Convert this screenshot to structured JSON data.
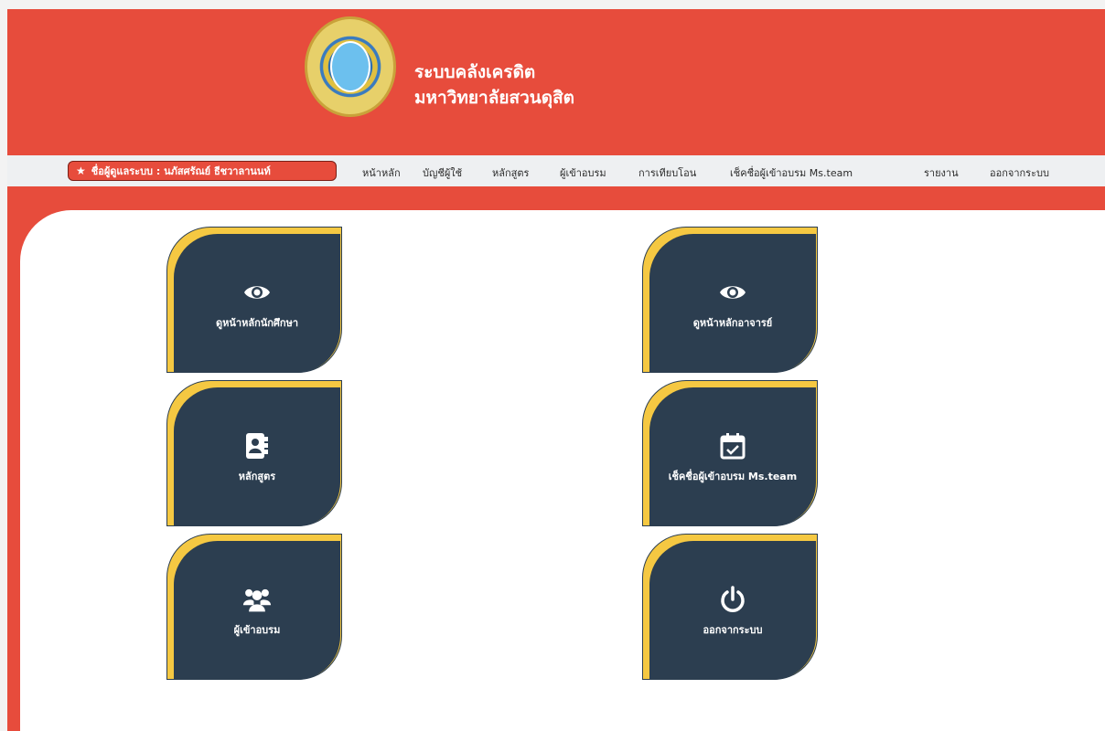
{
  "header": {
    "title_line1": "ระบบคลังเครดิต",
    "title_line2": "มหาวิทยาลัยสวนดุสิต"
  },
  "nav": {
    "admin_label": "ชื่อผู้ดูแลระบบ : นภัสศรัณย์ ธีชวาลานนท์",
    "items": [
      "หน้าหลัก",
      "บัญชีผู้ใช้",
      "หลักสูตร",
      "ผู้เข้าอบรม",
      "การเทียบโอน",
      "เช็คชื่อผู้เข้าอบรม Ms.team",
      "รายงาน",
      "ออกจากระบบ"
    ]
  },
  "tiles": [
    {
      "label": "ดูหน้าหลักนักศึกษา",
      "icon": "eye-icon"
    },
    {
      "label": "ดูหน้าหลักอาจารย์",
      "icon": "eye-icon"
    },
    {
      "label": "หลักสูตร",
      "icon": "address-book-icon"
    },
    {
      "label": "เช็คชื่อผู้เข้าอบรม Ms.team",
      "icon": "calendar-check-icon"
    },
    {
      "label": "ผู้เข้าอบรม",
      "icon": "users-icon"
    },
    {
      "label": "ออกจากระบบ",
      "icon": "power-icon"
    }
  ],
  "colors": {
    "primary": "#e74c3c",
    "tile": "#2c3e50",
    "accent": "#f5c842",
    "nav_bg": "#eef0f2"
  }
}
